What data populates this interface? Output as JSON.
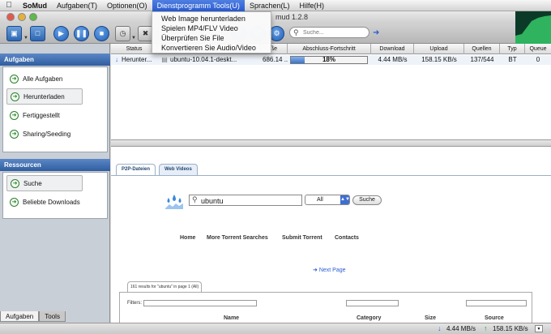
{
  "menubar": {
    "app_name": "SoMud",
    "items": [
      "Aufgaben(T)",
      "Optionen(O)",
      "Dienstprogramm Tools(U)",
      "Sprachen(L)",
      "Hilfe(H)"
    ]
  },
  "dropdown": {
    "items": [
      "Web Image herunterladen",
      "Spielen MP4/FLV Video",
      "Überprüfen Sie File",
      "Konvertieren Sie Audio/Video"
    ]
  },
  "window": {
    "title_suffix": "mud 1.2.8"
  },
  "toolbar": {
    "search_placeholder": "Suche..."
  },
  "sidebar": {
    "tasks_header": "Aufgaben",
    "task_items": [
      "Alle Aufgaben",
      "Herunterladen",
      "Fertiggestellt",
      "Sharing/Seeding"
    ],
    "resources_header": "Ressourcen",
    "resource_items": [
      "Suche",
      "Beliebte Downloads"
    ],
    "bottom_tabs": [
      "Aufgaben",
      "Tools"
    ]
  },
  "table": {
    "columns": [
      "Status",
      "ße",
      "Abschluss-Fortschritt",
      "Download",
      "Upload",
      "Quellen",
      "Typ",
      "Queue"
    ],
    "row": {
      "status": "Herunter...",
      "name": "ubuntu-10.04.1-deskt...",
      "size": "686.14 ...",
      "progress_label": "18%",
      "progress": 0.18,
      "download": "4.44 MB/s",
      "upload": "158.15 KB/s",
      "sources": "137/544",
      "type": "BT",
      "queue": "0"
    }
  },
  "web": {
    "tabs": [
      "P2P-Dateien",
      "Web Videos"
    ],
    "search_value": "ubuntu",
    "select_value": "All",
    "search_button": "Suche",
    "links": [
      "Home",
      "More Torrent Searches",
      "Submit Torrent",
      "Contacts"
    ],
    "next_page": "Next Page",
    "results_tab": "161 results for \"ubuntu\" in page 1 (All)",
    "filters_label": "Filters:",
    "result_headers": [
      "Name",
      "Category",
      "Size",
      "Source"
    ]
  },
  "statusbar": {
    "download": "4.44 MB/s",
    "upload": "158.15 KB/s"
  },
  "colors": {
    "accent": "#2a5cd3",
    "sidebar_header": "#3f6fb3",
    "progress": "#3c74c9"
  }
}
